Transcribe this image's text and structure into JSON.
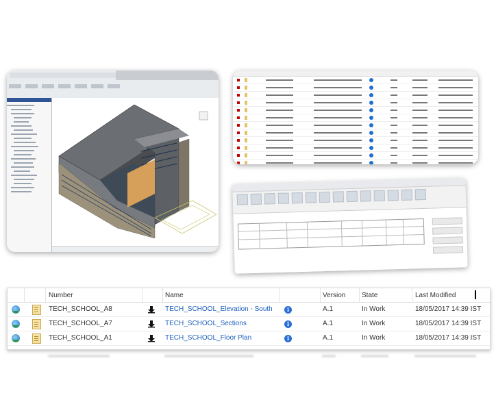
{
  "table": {
    "headers": {
      "number": "Number",
      "name": "Name",
      "version": "Version",
      "state": "State",
      "last_modified": "Last Modified"
    },
    "rows": [
      {
        "number": "TECH_SCHOOL_A8",
        "name": "TECH_SCHOOL_Elevation - South",
        "version": "A.1",
        "state": "In Work",
        "last_modified": "18/05/2017 14:39 IST"
      },
      {
        "number": "TECH_SCHOOL_A7",
        "name": "TECH_SCHOOL_Sections",
        "version": "A.1",
        "state": "In Work",
        "last_modified": "18/05/2017 14:39 IST"
      },
      {
        "number": "TECH_SCHOOL_A1",
        "name": "TECH_SCHOOL_Floor Plan",
        "version": "A.1",
        "state": "In Work",
        "last_modified": "18/05/2017 14:39 IST"
      }
    ]
  },
  "icons": {
    "row_type": "globe-icon",
    "document": "document-icon",
    "download": "download-arrow-icon",
    "info": "info-icon"
  },
  "colors": {
    "link": "#1d5fbf",
    "info": "#2a6fd6",
    "revit_red": "#c00000"
  }
}
